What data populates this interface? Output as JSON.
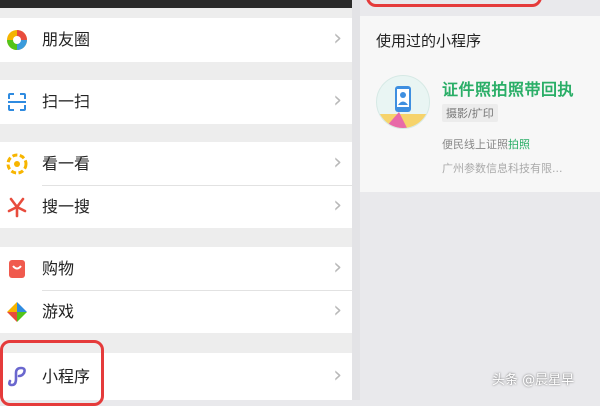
{
  "menu": {
    "items": [
      {
        "label": "朋友圈",
        "icon": "moments-icon"
      },
      {
        "label": "扫一扫",
        "icon": "scan-icon"
      },
      {
        "label": "看一看",
        "icon": "look-icon"
      },
      {
        "label": "搜一搜",
        "icon": "search-icon"
      },
      {
        "label": "购物",
        "icon": "shopping-icon"
      },
      {
        "label": "游戏",
        "icon": "game-icon"
      },
      {
        "label": "小程序",
        "icon": "miniprogram-icon"
      }
    ],
    "chevron": "›"
  },
  "right": {
    "section_title": "使用过的小程序",
    "app": {
      "name": "证件照拍照带回执",
      "tag": "摄影/扩印",
      "desc_prefix": "便民线上证照",
      "desc_highlight": "拍照",
      "company": "广州参数信息科技有限..."
    }
  },
  "watermark": "头条 @晨星早",
  "colors": {
    "accent_green": "#2aae67",
    "highlight_red": "#e53b3b"
  }
}
